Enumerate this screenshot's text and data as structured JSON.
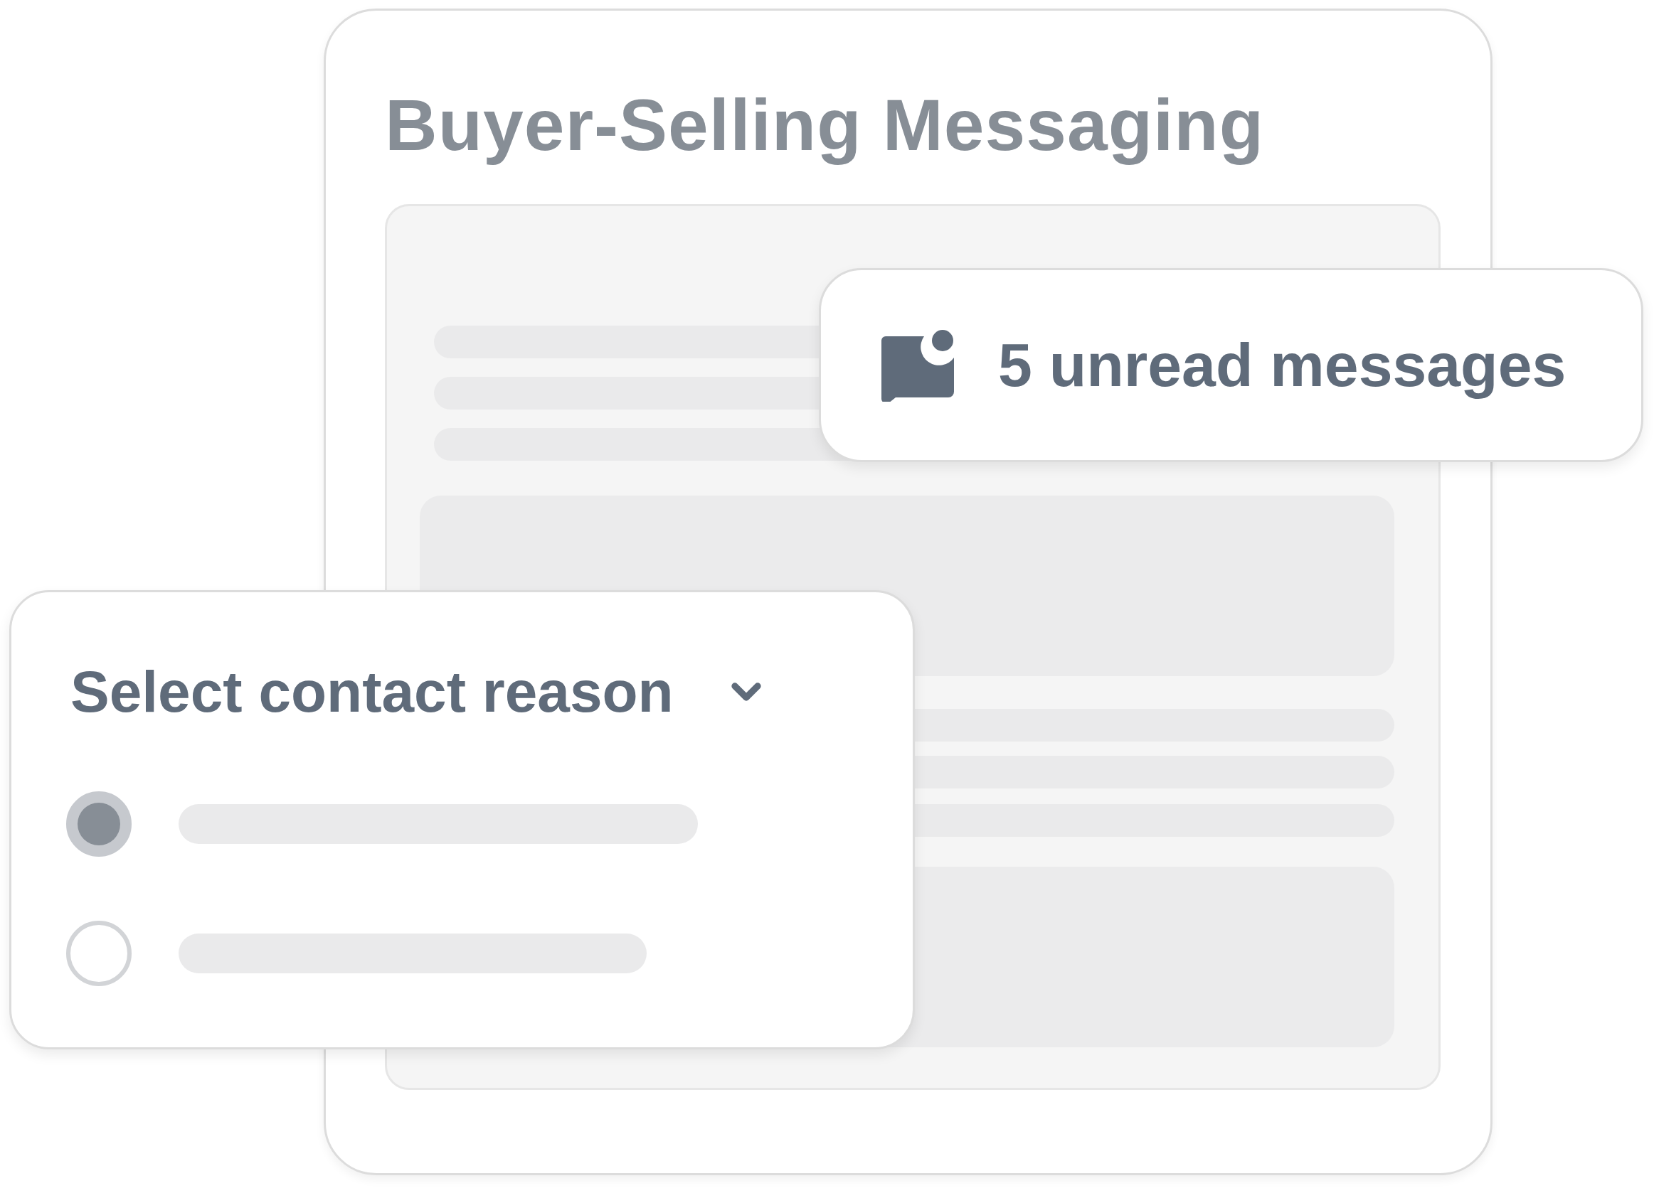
{
  "title": "Buyer-Selling Messaging",
  "notification": {
    "text": "5 unread messages"
  },
  "contact_reason": {
    "label": "Select contact reason",
    "options": [
      {
        "selected": true
      },
      {
        "selected": false
      }
    ]
  }
}
